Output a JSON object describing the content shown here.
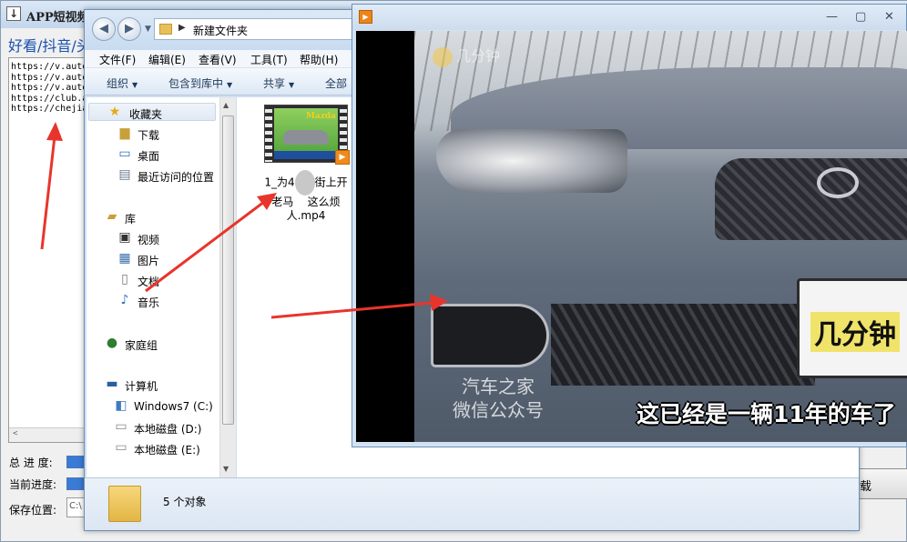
{
  "app": {
    "title": "APP短视频",
    "header": "好看/抖音/头",
    "urls": [
      "https://v.auto",
      "https://v.auto",
      "https://v.auto",
      "https://club.a",
      "https://chejia"
    ],
    "total_progress_label": "总 进 度:",
    "current_progress_label": "当前进度:",
    "save_location_label": "保存位置:",
    "save_path": "C:\\",
    "download_label": "载"
  },
  "explorer": {
    "address_path": "新建文件夹",
    "menus": [
      "文件(F)",
      "编辑(E)",
      "查看(V)",
      "工具(T)",
      "帮助(H)"
    ],
    "toolbar": [
      "组织",
      "包含到库中",
      "共享",
      "全部"
    ],
    "nav": {
      "favorites": "收藏夹",
      "downloads": "下载",
      "desktop": "桌面",
      "recent": "最近访问的位置",
      "libraries": "库",
      "videos": "视频",
      "pictures": "图片",
      "documents": "文档",
      "music": "音乐",
      "homegroup": "家庭组",
      "computer": "计算机",
      "drive_c": "Windows7 (C:)",
      "drive_d": "本地磁盘 (D:)",
      "drive_e": "本地磁盘 (E:)"
    },
    "file": {
      "name_part1": "1_为4",
      "name_part2": "街上开",
      "name_line2_a": "老马",
      "name_line2_b": "这么烦",
      "name_line3": "人.mp4",
      "thumb_brand": "Mazda"
    },
    "status_count": "5 个对象"
  },
  "player": {
    "watermark_top": "几分钟",
    "watermark_brand_line1": "汽车之家",
    "watermark_brand_line2": "微信公众号",
    "plate_text": "几分钟",
    "subtitle": "这已经是一辆11年的车了"
  },
  "colors": {
    "arrow": "#e8352b",
    "accent_blue": "#1a50b0",
    "progress": "#3a7bd5"
  }
}
